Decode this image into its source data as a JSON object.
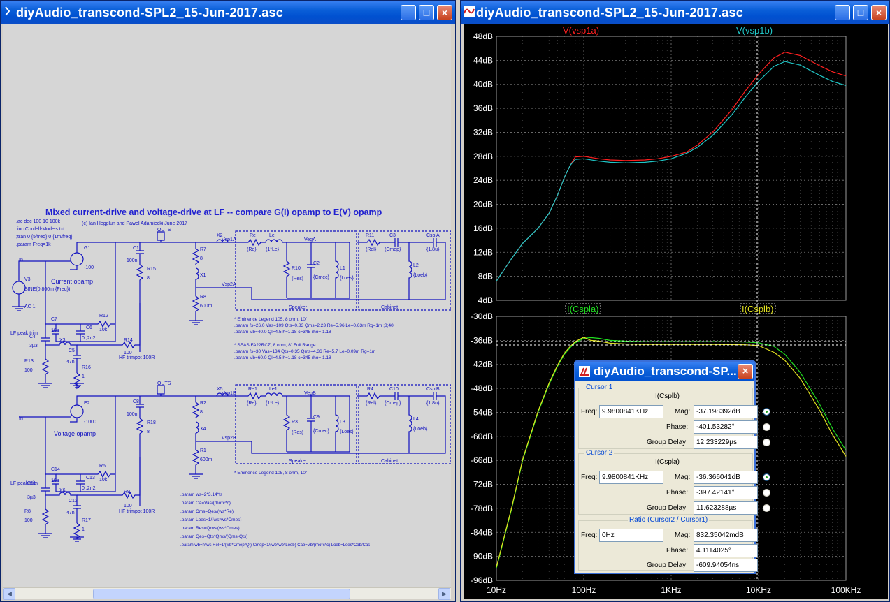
{
  "left_window": {
    "title": "diyAudio_transcond-SPL2_15-Jun-2017.asc",
    "schematic": {
      "heading": "Mixed current-drive and voltage-drive at LF -- compare G(I) opamp to E(V) opamp",
      "credit": "(c) Ian Hegglun and Pawel Adamiecki June 2017",
      "directives": [
        ".ac dec 100 10 100k",
        ".inc Cordell-Models.txt",
        ";tran 0 {5/freq} 0 {1m/freq}",
        ".param Freq=1k"
      ],
      "current_label": "Current opamp",
      "voltage_label": "Voltage opamp",
      "in_label": "In",
      "source_label": "SINE(0 800m {Freq})",
      "ac_label": "AC 1",
      "v3_label": "V3",
      "g1_label": "G1",
      "g1_val": "-100",
      "e2_label": "E2",
      "e2_val": "-1000",
      "lf_peak_trim": "LF peak trim",
      "hf_trimpot": "HF trimpot 100R",
      "speaker_label": "Speaker",
      "cabinet_label": "Cabinet",
      "vega": "VegA",
      "vegb": "VegB",
      "vsp1a": "Vsp1A",
      "vsp2a": "Vsp2A",
      "vsp1b": "Vsp1B",
      "vsp2b": "Vsp2B",
      "outs": "OUTS",
      "comp_top": [
        "X2",
        "Re",
        "Le",
        "{Re}",
        "{1*Le}",
        "R11",
        "C3",
        "{Rel}",
        "{Cmep}",
        "CsplA",
        "{1.8u}",
        "R10",
        "{Res}",
        "C2",
        "{Cmec}",
        "L1",
        "{Loes}",
        "L2",
        "{Loeb}",
        "R7",
        "8",
        "X1",
        "R8",
        "600m",
        "C1",
        "100n",
        "R15",
        "8"
      ],
      "comp_bottom": [
        "X5",
        "Re1",
        "Le1",
        "{Re}",
        "{1*Le}",
        "R4",
        "C10",
        "{Rel}",
        "{Cmep}",
        "CsplB",
        "{1.8u}",
        "R3",
        "{Res}",
        "C9",
        "{Cmec}",
        "L3",
        "{Loes}",
        "L4",
        "{Loeb}",
        "R2",
        "8",
        "X4",
        "R1",
        "600m",
        "C8",
        "100n",
        "R18",
        "8"
      ],
      "comp_trim_top": [
        "C7",
        "10n",
        "C6",
        "0 ;2n2",
        "R12",
        "10k",
        "C4",
        "3µ3",
        "X3",
        "C5",
        "47n",
        "R14",
        "100",
        "R13",
        "100",
        "R16",
        "1"
      ],
      "comp_trim_bottom": [
        "C14",
        "10n",
        "C13",
        "0 ;2n2",
        "R6",
        "10k",
        "C11",
        "3µ3",
        "X6",
        "C12",
        "47n",
        "R9",
        "100",
        "R8",
        "100",
        "R17",
        "1"
      ],
      "eminence": "* Eminence Legend 105, 8 ohm, 10\"",
      "eminence_params": [
        ".param fs=26.0 Vas=109 Qts=0.83 Qms=2.23 Re=5.96 Le=0.63m Rg=1m ;8;40",
        ".param Vb=40.0 Ql=4.5 h=1.18  c=345 rho= 1.18"
      ],
      "seas": "* SEAS FA22RCZ, 8 ohm, 8\" Full Range",
      "seas_params": [
        ".param fs=30 Vas=134 Qts=0.35 Qms=4.36 Re=5.7 Le=0.09m Rg=1m",
        ".param Vb=60.0 Ql=4.5 h=1.18  c=345 rho= 1.18"
      ],
      "eminence2": "* Eminence Legend 105, 8 ohm, 10\"",
      "formulas": [
        ".param ws=2*3.14*fs",
        ".param Ca=Vas/(rho*c*c)",
        ".param Cms=Qes/(ws*Re)",
        ".param Loes=1/(ws*ws*Cmes)",
        ".param Res=Qms/(ws*Cmes)",
        ".param Qes=Qts*Qms/(Qms-Qts)",
        ".param wb=h*ws  Rel=1/(wb*Cmep*Ql)  Cmep=1/(wb*wb*Loeb)  Cab=Vb/(rho*c*c)  Loeb=Loes*Cab/Cas"
      ]
    }
  },
  "right_window": {
    "title": "diyAudio_transcond-SPL2_15-Jun-2017.asc",
    "top_pane": {
      "traces": [
        {
          "name": "V(vsp1a)",
          "color": "#ff2020"
        },
        {
          "name": "V(vsp1b)",
          "color": "#20c8c8"
        }
      ],
      "y_ticks": [
        "48dB",
        "44dB",
        "40dB",
        "36dB",
        "32dB",
        "28dB",
        "24dB",
        "20dB",
        "16dB",
        "12dB",
        "8dB",
        "4dB"
      ]
    },
    "bottom_pane": {
      "traces": [
        {
          "name": "I(Cspla)",
          "color": "#20e020"
        },
        {
          "name": "I(Csplb)",
          "color": "#e0e020"
        }
      ],
      "y_ticks": [
        "-30dB",
        "-36dB",
        "-42dB",
        "-48dB",
        "-54dB",
        "-60dB",
        "-66dB",
        "-72dB",
        "-78dB",
        "-84dB",
        "-90dB",
        "-96dB"
      ]
    },
    "x_ticks": [
      "10Hz",
      "100Hz",
      "1KHz",
      "10KHz",
      "100KHz"
    ]
  },
  "cursor_dialog": {
    "title": "diyAudio_transcond-SP...",
    "cursor1": {
      "group": "Cursor 1",
      "trace": "I(Csplb)",
      "freq_label": "Freq:",
      "freq": "9.9800841KHz",
      "mag_label": "Mag:",
      "mag": "-37.198392dB",
      "phase_label": "Phase:",
      "phase": "-401.53282°",
      "gd_label": "Group Delay:",
      "gd": "12.233229µs"
    },
    "cursor2": {
      "group": "Cursor 2",
      "trace": "I(Cspla)",
      "freq_label": "Freq:",
      "freq": "9.9800841KHz",
      "mag_label": "Mag:",
      "mag": "-36.366041dB",
      "phase_label": "Phase:",
      "phase": "-397.42141°",
      "gd_label": "Group Delay:",
      "gd": "11.623288µs"
    },
    "ratio": {
      "group": "Ratio (Cursor2 / Cursor1)",
      "freq_label": "Freq:",
      "freq": "0Hz",
      "mag_label": "Mag:",
      "mag": "832.35042mdB",
      "phase_label": "Phase:",
      "phase": "4.1114025°",
      "gd_label": "Group Delay:",
      "gd": "-609.94054ns"
    }
  }
}
